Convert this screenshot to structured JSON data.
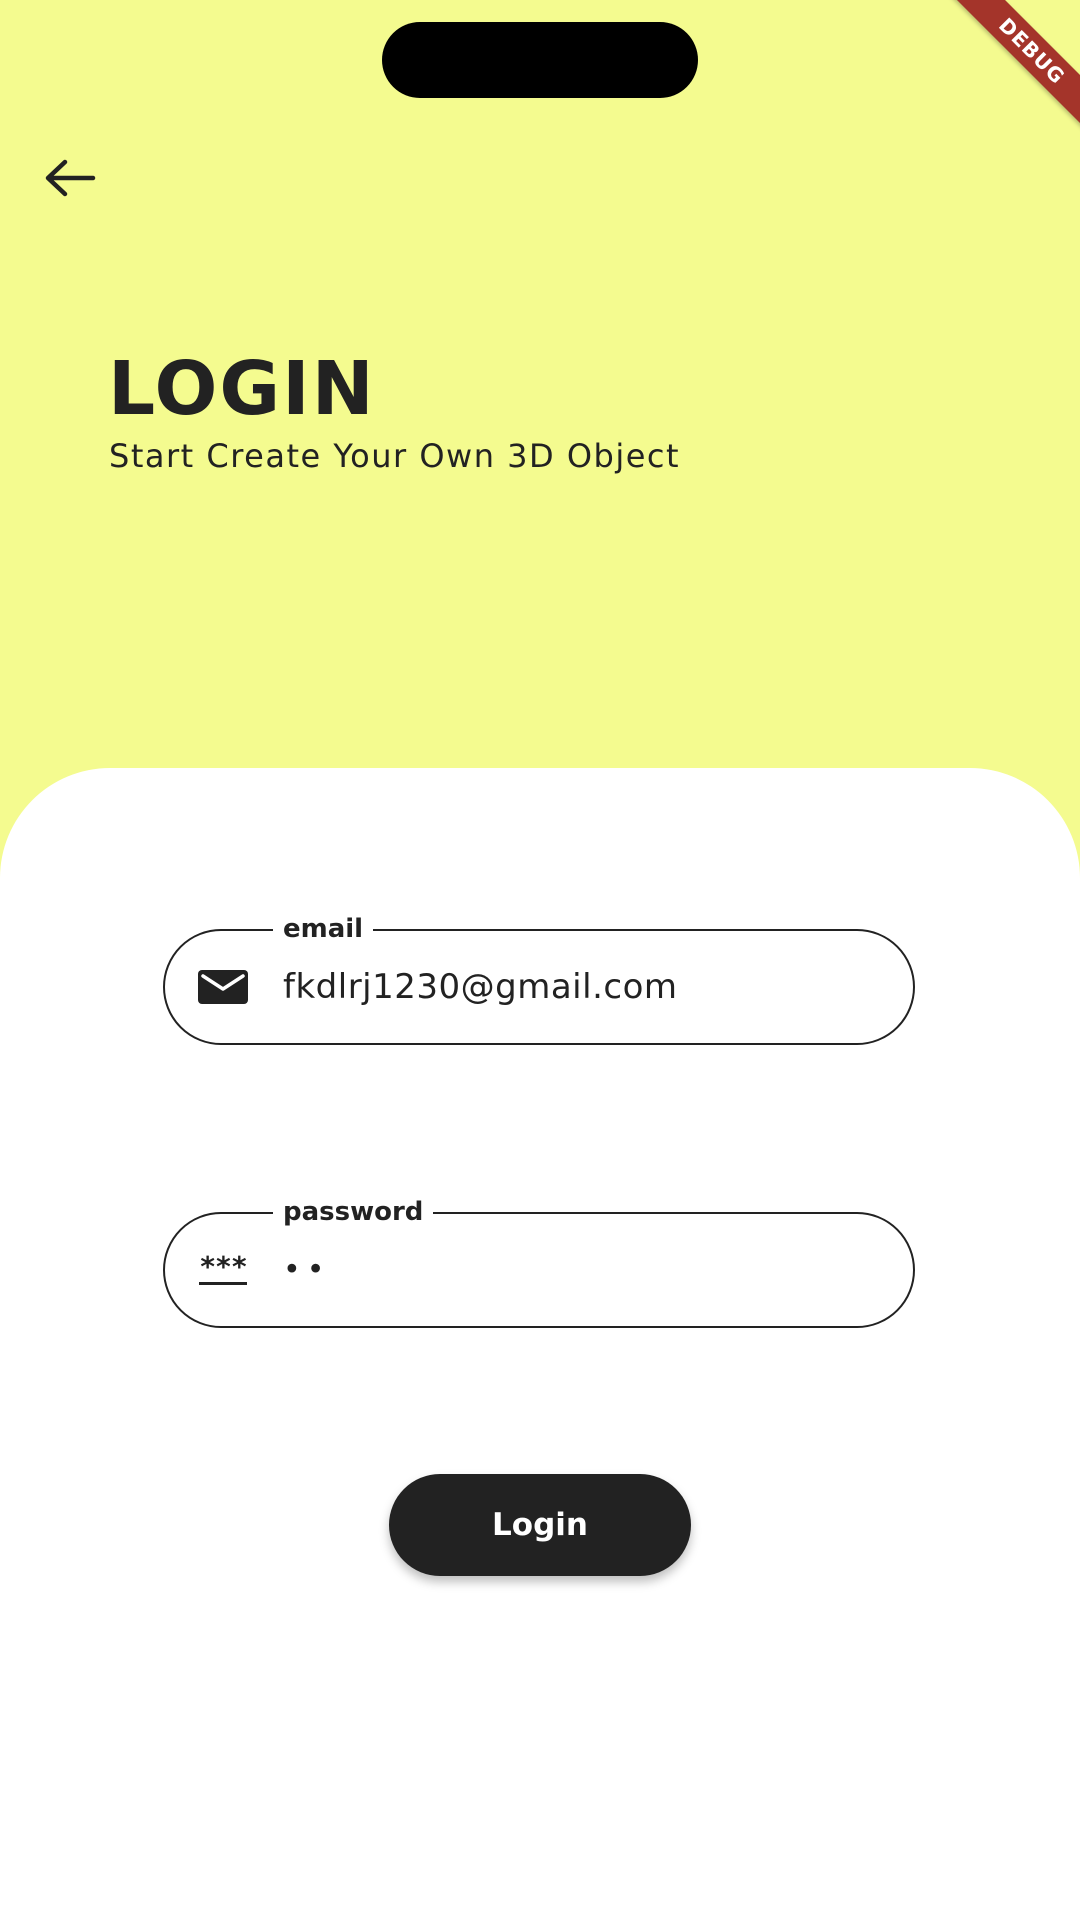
{
  "debug_banner": "DEBUG",
  "header": {
    "title": "LOGIN",
    "subtitle": "Start Create Your Own 3D Object"
  },
  "form": {
    "email": {
      "label": "email",
      "value": "fkdlrj1230@gmail.com",
      "icon": "mail-icon"
    },
    "password": {
      "label": "password",
      "value": "••",
      "icon": "password-icon",
      "icon_glyph": "***"
    },
    "login_button_label": "Login"
  },
  "colors": {
    "background": "#f4fb8f",
    "card": "#ffffff",
    "text": "#222222",
    "button": "#222222",
    "button_text": "#ffffff",
    "debug_banner": "#a4342a"
  }
}
